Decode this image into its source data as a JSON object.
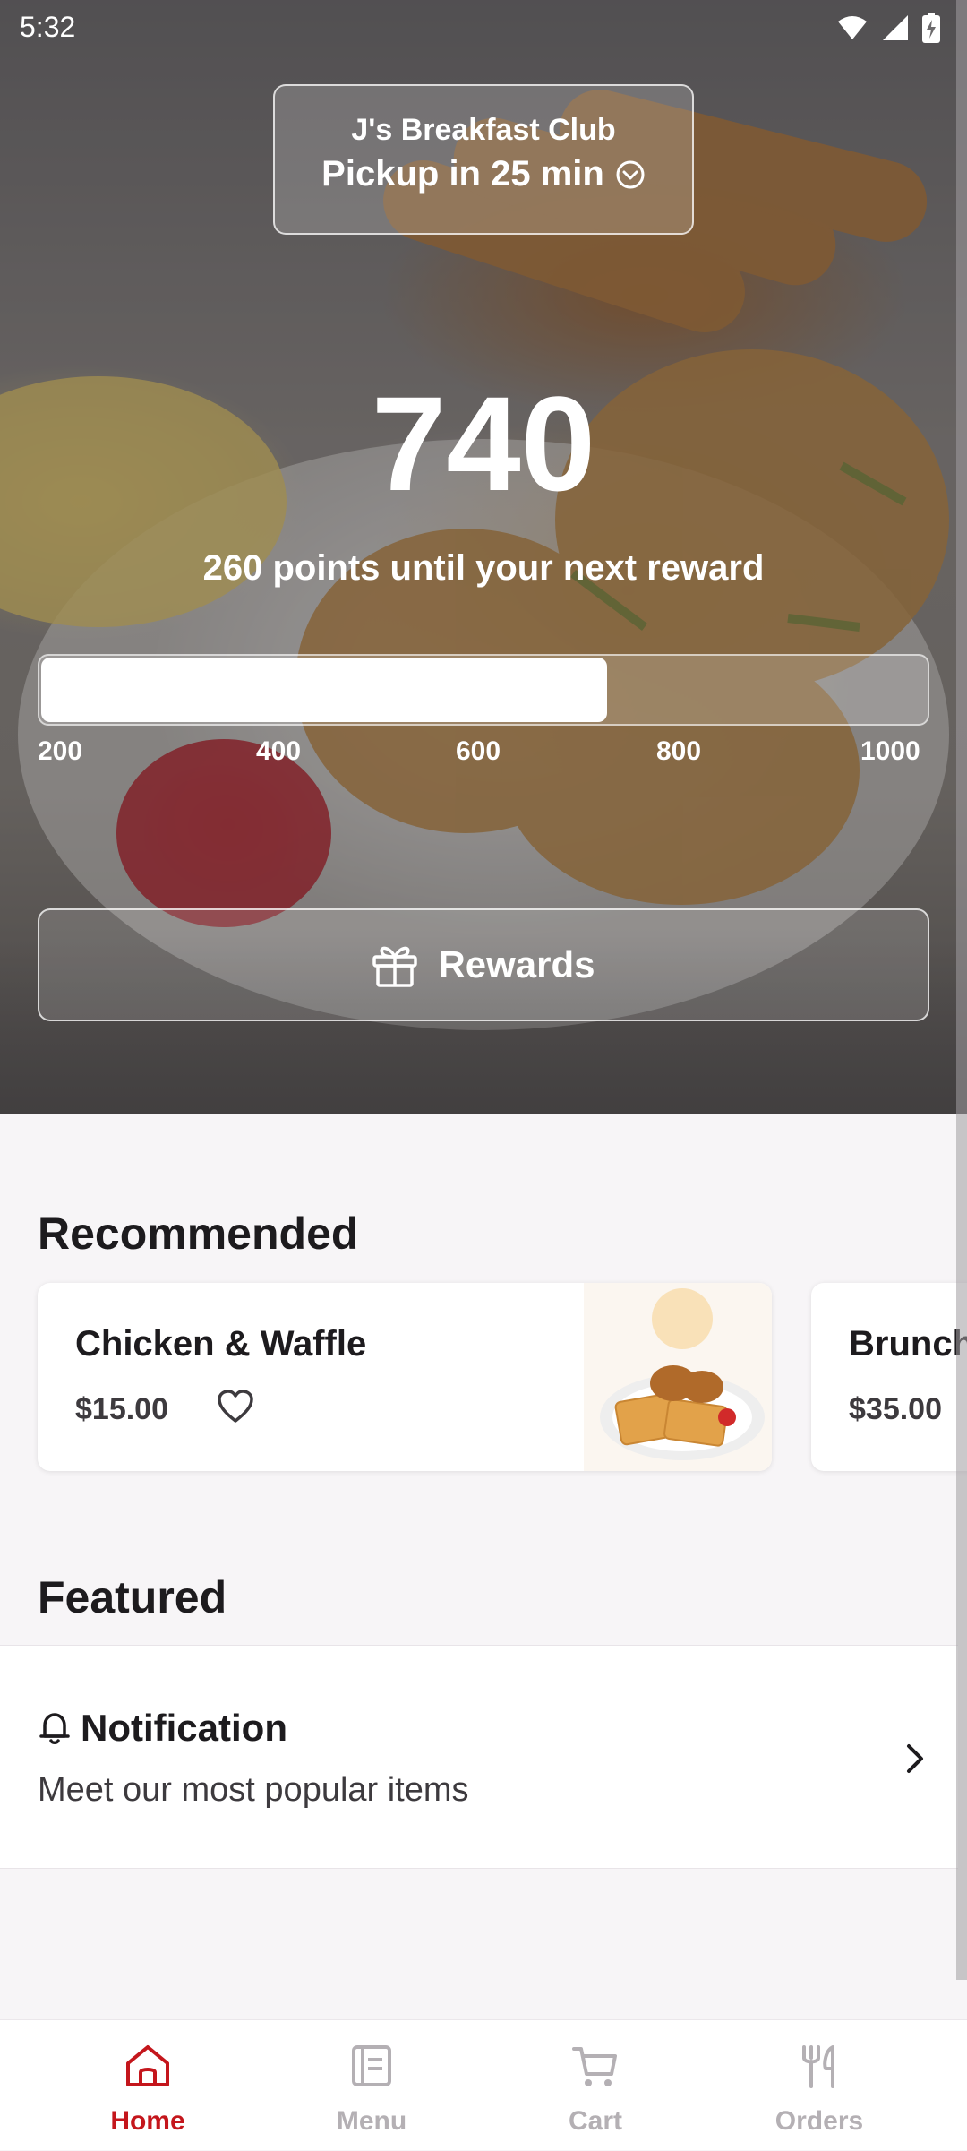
{
  "status_bar": {
    "time": "5:32"
  },
  "header": {
    "store_name": "J's Breakfast Club",
    "pickup_text": "Pickup in 25 min"
  },
  "rewards": {
    "points": "740",
    "points_message": "260 points until your next reward",
    "progress_fraction": 0.64,
    "ticks": [
      "200",
      "400",
      "600",
      "800",
      "1000"
    ],
    "button_label": "Rewards"
  },
  "recommended": {
    "title": "Recommended",
    "items": [
      {
        "name": "Chicken & Waffle",
        "price": "$15.00"
      },
      {
        "name": "Brunch",
        "price": "$35.00"
      }
    ]
  },
  "featured": {
    "title": "Featured",
    "notification_title": "Notification",
    "notification_text": "Meet our most popular items"
  },
  "bottom_nav": {
    "items": [
      {
        "label": "Home",
        "icon": "home-icon",
        "active": true
      },
      {
        "label": "Menu",
        "icon": "menu-icon",
        "active": false
      },
      {
        "label": "Cart",
        "icon": "cart-icon",
        "active": false
      },
      {
        "label": "Orders",
        "icon": "orders-icon",
        "active": false
      }
    ]
  },
  "colors": {
    "accent": "#c4161c",
    "inactive": "#b4b0b4",
    "page_background": "#f7f5f7"
  }
}
